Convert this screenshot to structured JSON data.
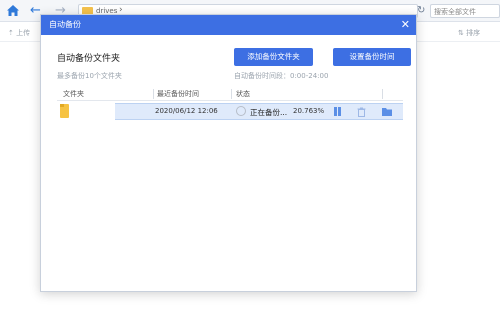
{
  "background": {
    "path": "drives",
    "search_placeholder": "搜索全部文件",
    "upload_label": "上传",
    "sort_label": "排序"
  },
  "dialog": {
    "title": "自动备份",
    "section_title": "自动备份文件夹",
    "hint": "最多备份10个文件夹",
    "add_button": "添加备份文件夹",
    "set_time_button": "设置备份时间",
    "time_range": "自动备份时间段：0:00-24:00",
    "columns": [
      "文件夹",
      "最近备份时间",
      "状态"
    ],
    "rows": [
      {
        "last_backup": "2020/06/12 12:06",
        "status": "正在备份...",
        "percent": "20.763%"
      }
    ]
  },
  "colors": {
    "accent": "#3d6fe3",
    "folder": "#f6c343",
    "selected_row": "#dfeafb"
  }
}
